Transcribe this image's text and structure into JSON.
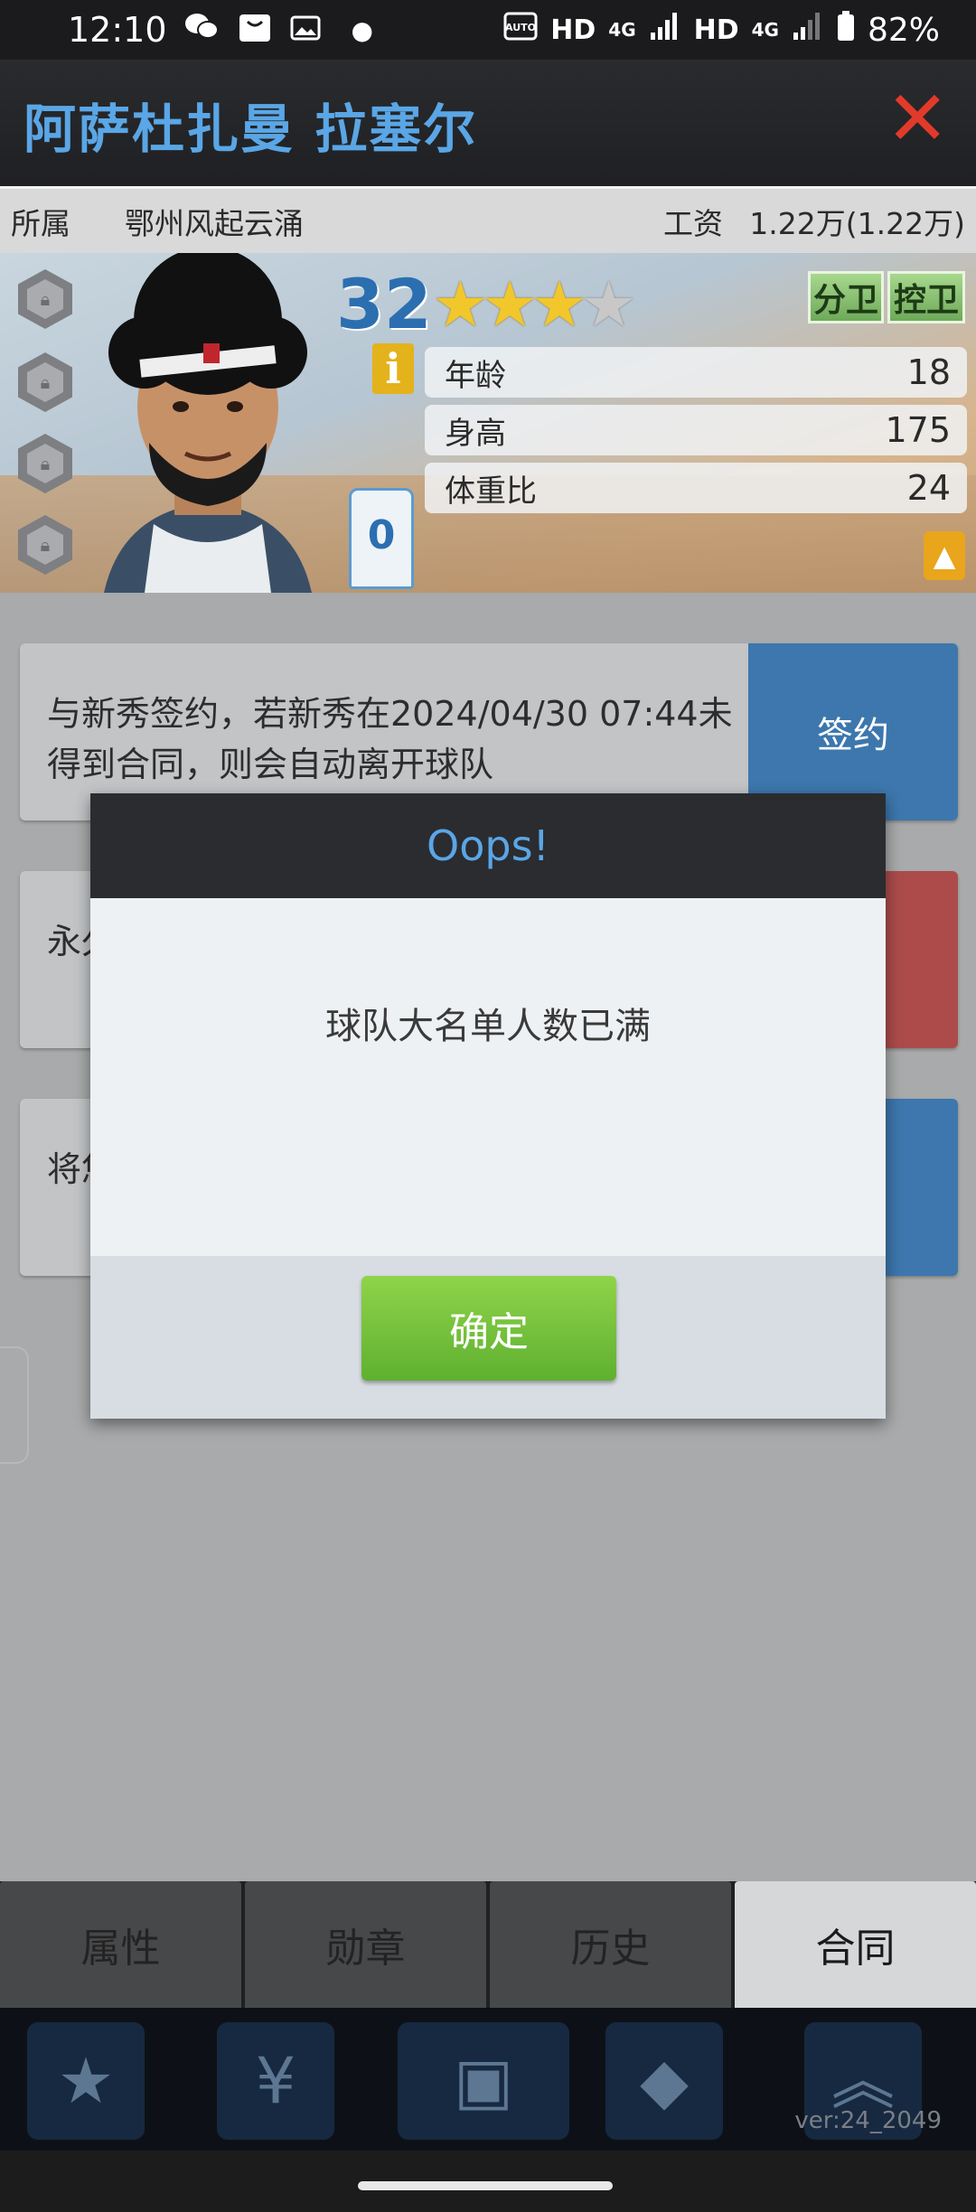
{
  "status_bar": {
    "time": "12:10",
    "icons": [
      "wechat-icon",
      "bag-icon",
      "image-icon",
      "dot-icon",
      "auto-hz-icon",
      "signal-icon",
      "battery-icon"
    ],
    "hd1": "HD",
    "net1": "4G",
    "hd2": "HD",
    "net2": "4G",
    "battery": "82%"
  },
  "header": {
    "player_name": "阿萨杜扎曼 拉塞尔",
    "close_icon": "close-icon"
  },
  "info": {
    "team_label": "所属",
    "team": "鄂州风起云涌",
    "salary_label": "工资",
    "salary": "1.22万(1.22万)"
  },
  "player": {
    "overall": "32",
    "stars_filled": 3,
    "stars_total": 4,
    "positions": [
      "分卫",
      "控卫"
    ],
    "jersey": "0",
    "stats": [
      {
        "label": "年龄",
        "value": "18"
      },
      {
        "label": "身高",
        "value": "175"
      },
      {
        "label": "体重比",
        "value": "24"
      }
    ],
    "info_badge": "i"
  },
  "contract_rows": [
    {
      "text": "与新秀签约，若新秀在2024/04/30 07:44未得到合同，则会自动离开球队",
      "button": "签约",
      "color": "#3d77ad"
    },
    {
      "text": "永久",
      "button": "",
      "color": "#ad4b4b"
    },
    {
      "text": "将您",
      "button": "",
      "color": "#3d77ad"
    }
  ],
  "tabs": [
    "属性",
    "勋章",
    "历史",
    "合同"
  ],
  "active_tab": "合同",
  "bottom_nav": {
    "version": "ver:24_2049"
  },
  "dialog": {
    "title": "Oops!",
    "message": "球队大名单人数已满",
    "ok_label": "确定"
  }
}
